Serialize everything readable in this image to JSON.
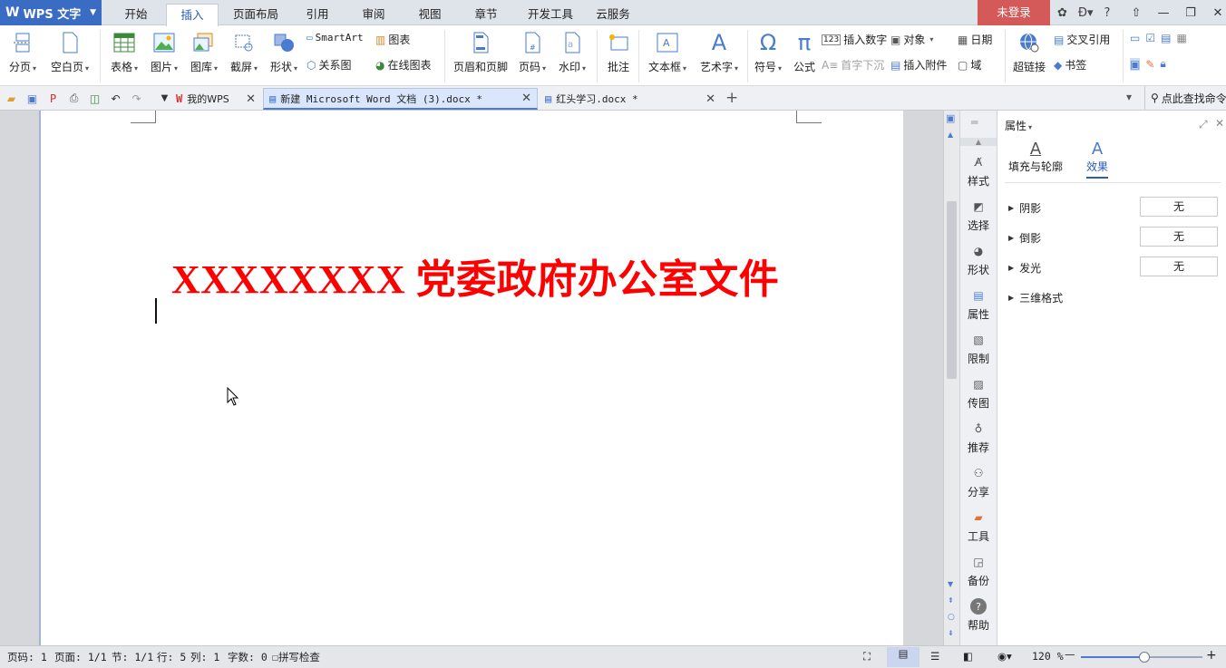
{
  "app": {
    "name": "WPS 文字",
    "logo": "W"
  },
  "menu": {
    "tabs": [
      {
        "label": "开始"
      },
      {
        "label": "插入"
      },
      {
        "label": "页面布局"
      },
      {
        "label": "引用"
      },
      {
        "label": "审阅"
      },
      {
        "label": "视图"
      },
      {
        "label": "章节"
      },
      {
        "label": "开发工具"
      },
      {
        "label": "云服务"
      }
    ],
    "active_tab": "插入",
    "login_label": "未登录",
    "help_label": "?"
  },
  "ribbon": {
    "page_break": "分页",
    "blank_page": "空白页",
    "table": "表格",
    "picture": "图片",
    "gallery": "图库",
    "screenshot": "截屏",
    "shape": "形状",
    "smartart": "SmartArt",
    "chart": "图表",
    "relation": "关系图",
    "online_chart": "在线图表",
    "header_footer": "页眉和页脚",
    "page_number": "页码",
    "watermark": "水印",
    "comment": "批注",
    "textbox": "文本框",
    "wordart": "艺术字",
    "symbol": "符号",
    "formula": "公式",
    "insert_number": "插入数字",
    "object": "对象",
    "date": "日期",
    "drop_cap": "首字下沉",
    "attachment": "插入附件",
    "field": "域",
    "hyperlink": "超链接",
    "cross_ref": "交叉引用",
    "bookmark": "书签"
  },
  "tabs": {
    "home_tab": "我的WPS",
    "doc1": "新建 Microsoft Word 文档 (3).docx *",
    "doc2": "红头学习.docx *",
    "search_cmd": "点此查找命令"
  },
  "document": {
    "title_text": "XXXXXXXX 党委政府办公室文件",
    "title_color": "#ff0000"
  },
  "sidebar": {
    "items": [
      {
        "label": "样式",
        "icon": "style-icon"
      },
      {
        "label": "选择",
        "icon": "select-icon"
      },
      {
        "label": "形状",
        "icon": "shape-icon"
      },
      {
        "label": "属性",
        "icon": "properties-icon"
      },
      {
        "label": "限制",
        "icon": "restrict-icon"
      },
      {
        "label": "传图",
        "icon": "upload-image-icon"
      },
      {
        "label": "推荐",
        "icon": "recommend-icon"
      },
      {
        "label": "分享",
        "icon": "share-icon"
      },
      {
        "label": "工具",
        "icon": "toolbox-icon"
      },
      {
        "label": "备份",
        "icon": "backup-icon"
      },
      {
        "label": "帮助",
        "icon": "help-icon"
      }
    ]
  },
  "panel": {
    "title": "属性",
    "tab_fill": "填充与轮廓",
    "tab_effect": "效果",
    "shadow": "阴影",
    "shadow_value": "无",
    "reflection": "倒影",
    "reflection_value": "无",
    "glow": "发光",
    "glow_value": "无",
    "three_d": "三维格式"
  },
  "status": {
    "page_code": "页码: 1",
    "page": "页面: 1/1",
    "section": "节: 1/1",
    "row": "行: 5",
    "col": "列: 1",
    "word_count": "字数: 0",
    "spell_check": "拼写检查",
    "zoom": "120 %",
    "zoom_level": 0.52
  }
}
